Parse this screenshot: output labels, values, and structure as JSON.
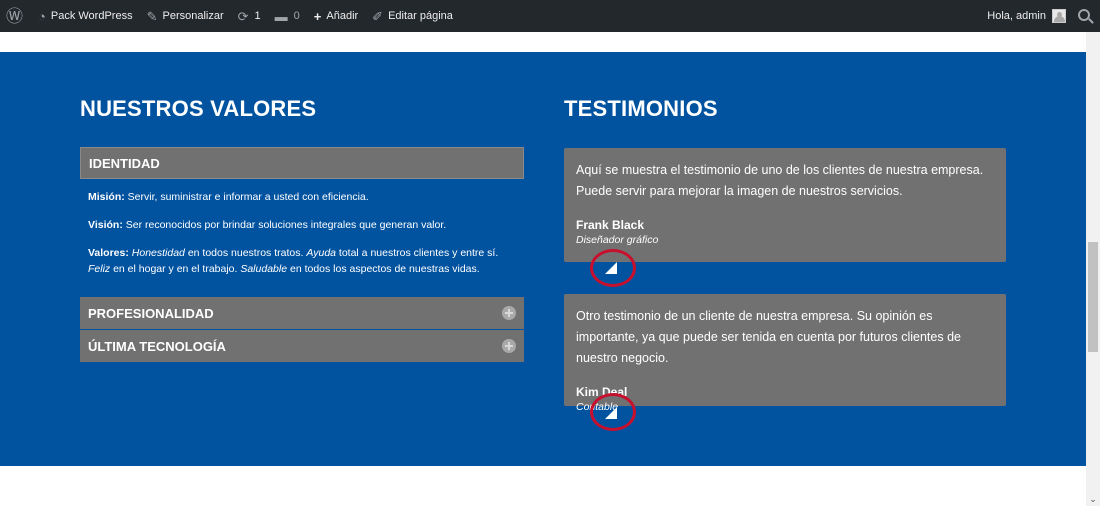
{
  "adminbar": {
    "wp_logo": "wordpress-logo-icon",
    "site_name": "Pack WordPress",
    "customize": "Personalizar",
    "updates_count": "1",
    "comments_count": "0",
    "add_new": "Añadir",
    "edit_page": "Editar página",
    "greeting": "Hola, admin"
  },
  "values": {
    "title": "NUESTROS VALORES",
    "panels": [
      {
        "title": "IDENTIDAD",
        "mision_label": "Misión:",
        "mision_text": "Servir, suministrar e informar a usted con eficiencia.",
        "vision_label": "Visión:",
        "vision_text": "Ser reconocidos por brindar soluciones integrales que generan valor.",
        "valores_label": "Valores:",
        "valores_t1": "Honestidad",
        "valores_t2": " en todos nuestros tratos. ",
        "valores_t3": "Ayuda",
        "valores_t4": " total a nuestros clientes y entre sí. ",
        "valores_t5": "Feliz",
        "valores_t6": " en el hogar y en el trabajo. ",
        "valores_t7": "Saludable",
        "valores_t8": " en todos los aspectos de nuestras vidas."
      },
      {
        "title": "PROFESIONALIDAD"
      },
      {
        "title": "ÚLTIMA TECNOLOGÍA"
      }
    ]
  },
  "testimonials": {
    "title": "TESTIMONIOS",
    "items": [
      {
        "quote": "Aquí se muestra el testimonio de uno de los clientes de nuestra empresa. Puede servir para mejorar la imagen de nuestros servicios.",
        "name": "Frank Black",
        "role": "Diseñador gráfico"
      },
      {
        "quote": "Otro testimonio de un cliente de nuestra empresa. Su opinión es importante, ya que puede ser tenida en cuenta por futuros clientes de nuestro negocio.",
        "name": "Kim Deal",
        "role": "Contable"
      }
    ]
  },
  "colors": {
    "section_bg": "#0153a0",
    "panel_bg": "#717171",
    "adminbar_bg": "#23282d",
    "annotation_ring": "#c8102e"
  }
}
